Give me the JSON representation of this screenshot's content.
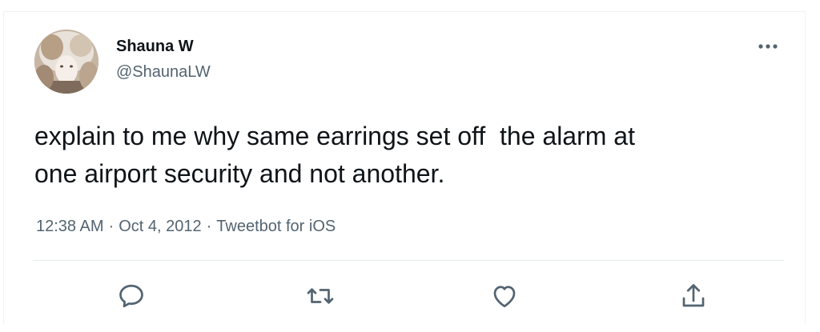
{
  "author": {
    "display_name": "Shauna W",
    "handle": "@ShaunaLW",
    "avatar_icon": "user-avatar"
  },
  "more_icon": "more-horizontal-icon",
  "tweet": {
    "text": "explain to me why same earrings set off  the alarm at\none airport security and not another."
  },
  "meta": {
    "time": "12:38 AM",
    "separator": "·",
    "date": "Oct 4, 2012",
    "client": "Tweetbot for iOS"
  },
  "actions": [
    {
      "name": "reply",
      "icon": "reply-icon"
    },
    {
      "name": "retweet",
      "icon": "retweet-icon"
    },
    {
      "name": "like",
      "icon": "heart-icon"
    },
    {
      "name": "share",
      "icon": "share-icon"
    }
  ],
  "colors": {
    "text_primary": "#0f1419",
    "text_secondary": "#536471",
    "divider": "#e6ecf0"
  }
}
